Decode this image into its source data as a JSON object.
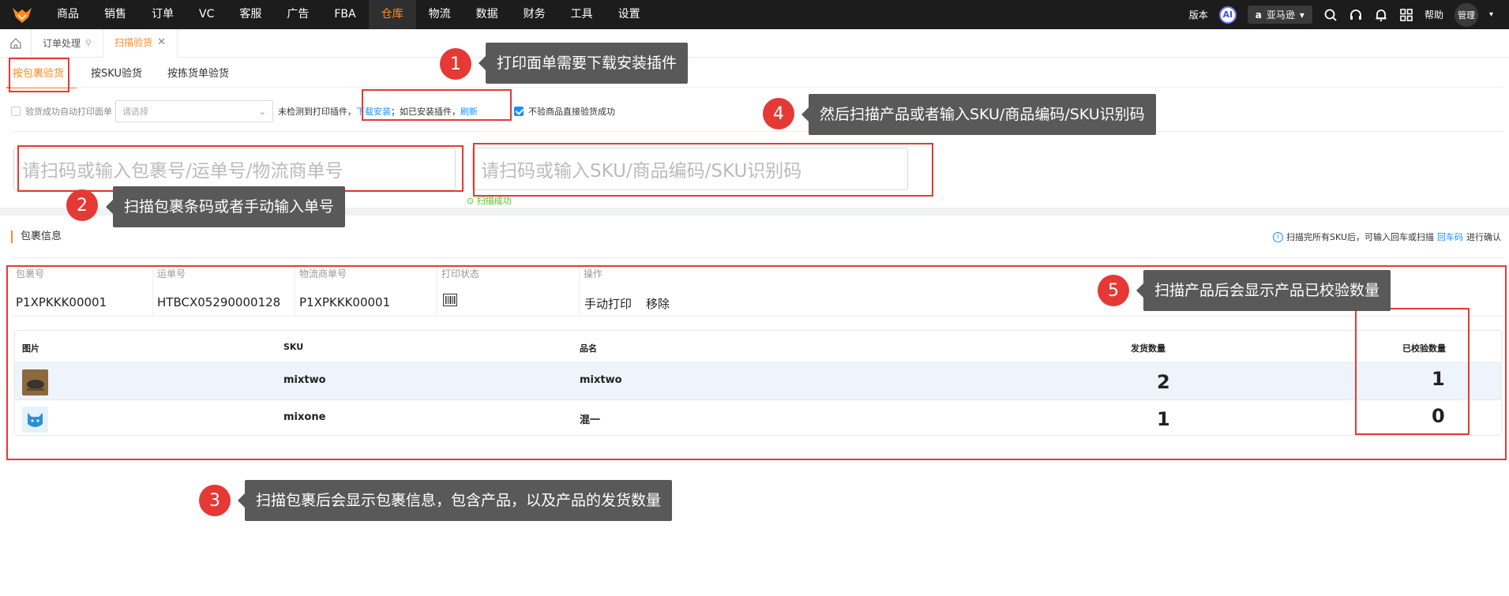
{
  "topnav": {
    "items": [
      {
        "label": "商品"
      },
      {
        "label": "销售"
      },
      {
        "label": "订单"
      },
      {
        "label": "VC"
      },
      {
        "label": "客服"
      },
      {
        "label": "广告"
      },
      {
        "label": "FBA"
      },
      {
        "label": "仓库",
        "active": true
      },
      {
        "label": "物流"
      },
      {
        "label": "数据"
      },
      {
        "label": "财务"
      },
      {
        "label": "工具"
      },
      {
        "label": "设置"
      }
    ],
    "version_label": "版本",
    "ai_label": "AI",
    "store_label": "亚马逊",
    "help_label": "帮助",
    "user_label": "管理"
  },
  "page_tabs": {
    "items": [
      {
        "label": "订单处理"
      },
      {
        "label": "扫描验货",
        "active": true
      }
    ]
  },
  "sub_tabs": [
    "按包裹验货",
    "按SKU验货",
    "按拣货单验货"
  ],
  "options": {
    "auto_print_label": "验货成功自动打印面单",
    "select_placeholder": "请选择",
    "plugin_text_1": "未检测到打印插件，",
    "download_link": "下载安装",
    "plugin_text_2": "；如已安装插件，",
    "refresh_link": "刷新",
    "skip_check_label": "不验商品直接验货成功"
  },
  "scan": {
    "package_placeholder": "请扫码或输入包裹号/运单号/物流商单号",
    "sku_placeholder": "请扫码或输入SKU/商品编码/SKU识别码",
    "success_text": "扫描成功"
  },
  "package_section": {
    "title": "包裹信息",
    "hint_prefix": "扫描完所有SKU后，可输入回车或扫描",
    "hint_link": "回车码",
    "hint_suffix": "进行确认"
  },
  "package_table": {
    "headers": [
      "包裹号",
      "运单号",
      "物流商单号",
      "打印状态",
      "操作"
    ],
    "row": {
      "package_no": "P1XPKKK00001",
      "tracking_no": "HTBCX05290000128",
      "carrier_no": "P1XPKKK00001",
      "manual_print": "手动打印",
      "remove": "移除"
    }
  },
  "items_table": {
    "headers": [
      "图片",
      "SKU",
      "品名",
      "发货数量",
      "已校验数量"
    ],
    "rows": [
      {
        "sku": "mixtwo",
        "name": "mixtwo",
        "ship_qty": "2",
        "checked_qty": "1"
      },
      {
        "sku": "mixone",
        "name": "混一",
        "ship_qty": "1",
        "checked_qty": "0"
      }
    ]
  },
  "annotations": [
    {
      "num": "1",
      "text": "打印面单需要下载安装插件"
    },
    {
      "num": "2",
      "text": "扫描包裹条码或者手动输入单号"
    },
    {
      "num": "3",
      "text": "扫描包裹后会显示包裹信息，包含产品，以及产品的发货数量"
    },
    {
      "num": "4",
      "text": "然后扫描产品或者输入SKU/商品编码/SKU识别码"
    },
    {
      "num": "5",
      "text": "扫描产品后会显示产品已校验数量"
    }
  ],
  "colors": {
    "accent": "#ff8a1f",
    "link": "#1890ff",
    "annotation": "#e53935",
    "callout": "#595959",
    "nav_bg": "#1c1c1c"
  }
}
